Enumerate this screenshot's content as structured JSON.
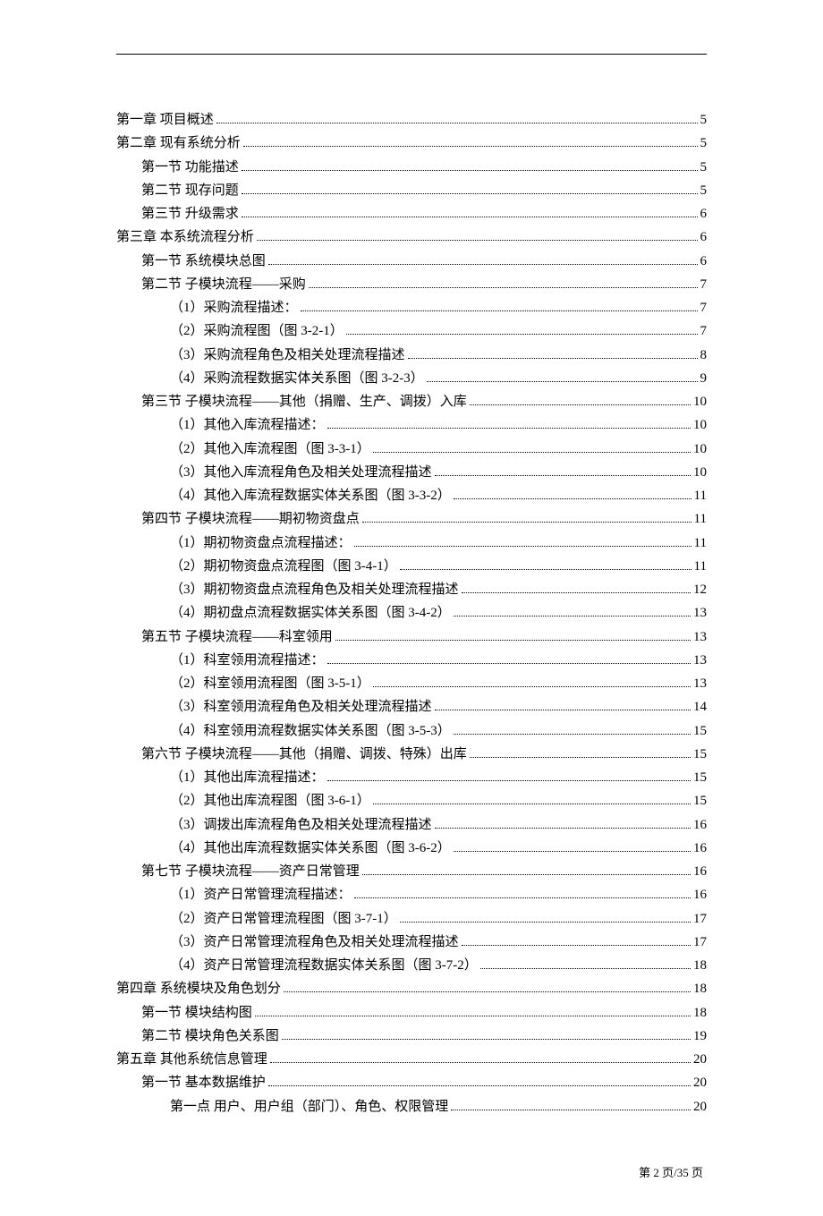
{
  "toc": [
    {
      "level": 0,
      "label": "第一章  项目概述",
      "page": "5"
    },
    {
      "level": 0,
      "label": "第二章  现有系统分析",
      "page": "5"
    },
    {
      "level": 1,
      "label": "第一节  功能描述",
      "page": "5"
    },
    {
      "level": 1,
      "label": "第二节  现存问题",
      "page": "5"
    },
    {
      "level": 1,
      "label": "第三节  升级需求",
      "page": "6"
    },
    {
      "level": 0,
      "label": "第三章  本系统流程分析",
      "page": "6"
    },
    {
      "level": 1,
      "label": "第一节  系统模块总图",
      "page": "6"
    },
    {
      "level": 1,
      "label": "第二节  子模块流程——采购",
      "page": "7"
    },
    {
      "level": 2,
      "label": "（1）采购流程描述：",
      "page": "7"
    },
    {
      "level": 2,
      "label": "（2）采购流程图（图 3-2-1）",
      "page": "7"
    },
    {
      "level": 2,
      "label": "（3）采购流程角色及相关处理流程描述",
      "page": "8"
    },
    {
      "level": 2,
      "label": "（4）采购流程数据实体关系图（图 3-2-3）",
      "page": "9"
    },
    {
      "level": 1,
      "label": "第三节  子模块流程——其他（捐赠、生产、调拨）入库",
      "page": "10"
    },
    {
      "level": 2,
      "label": "（1）其他入库流程描述：",
      "page": "10"
    },
    {
      "level": 2,
      "label": "（2）其他入库流程图（图 3-3-1）",
      "page": "10"
    },
    {
      "level": 2,
      "label": "（3）其他入库流程角色及相关处理流程描述",
      "page": "10"
    },
    {
      "level": 2,
      "label": "（4）其他入库流程数据实体关系图（图 3-3-2）",
      "page": "11"
    },
    {
      "level": 1,
      "label": "第四节  子模块流程——期初物资盘点",
      "page": "11"
    },
    {
      "level": 2,
      "label": "（1）期初物资盘点流程描述：",
      "page": "11"
    },
    {
      "level": 2,
      "label": "（2）期初物资盘点流程图（图 3-4-1）",
      "page": "11"
    },
    {
      "level": 2,
      "label": "（3）期初物资盘点流程角色及相关处理流程描述",
      "page": "12"
    },
    {
      "level": 2,
      "label": "（4）期初盘点流程数据实体关系图（图 3-4-2）",
      "page": "13"
    },
    {
      "level": 1,
      "label": "第五节  子模块流程——科室领用",
      "page": "13"
    },
    {
      "level": 2,
      "label": "（1）科室领用流程描述：",
      "page": "13"
    },
    {
      "level": 2,
      "label": "（2）科室领用流程图（图 3-5-1）",
      "page": "13"
    },
    {
      "level": 2,
      "label": "（3）科室领用流程角色及相关处理流程描述",
      "page": "14"
    },
    {
      "level": 2,
      "label": "（4）科室领用流程数据实体关系图（图 3-5-3）",
      "page": "15"
    },
    {
      "level": 1,
      "label": "第六节  子模块流程——其他（捐赠、调拨、特殊）出库",
      "page": "15"
    },
    {
      "level": 2,
      "label": "（1）其他出库流程描述：",
      "page": "15"
    },
    {
      "level": 2,
      "label": "（2）其他出库流程图（图 3-6-1）",
      "page": "15"
    },
    {
      "level": 2,
      "label": "（3）调拨出库流程角色及相关处理流程描述",
      "page": "16"
    },
    {
      "level": 2,
      "label": "（4）其他出库流程数据实体关系图（图 3-6-2）",
      "page": "16"
    },
    {
      "level": 1,
      "label": "第七节  子模块流程——资产日常管理",
      "page": "16"
    },
    {
      "level": 2,
      "label": "（1）资产日常管理流程描述：",
      "page": "16"
    },
    {
      "level": 2,
      "label": "（2）资产日常管理流程图（图 3-7-1）",
      "page": "17"
    },
    {
      "level": 2,
      "label": "（3）资产日常管理流程角色及相关处理流程描述",
      "page": "17"
    },
    {
      "level": 2,
      "label": "（4）资产日常管理流程数据实体关系图（图 3-7-2）",
      "page": "18"
    },
    {
      "level": 0,
      "label": "第四章  系统模块及角色划分",
      "page": "18"
    },
    {
      "level": 1,
      "label": "第一节  模块结构图",
      "page": "18"
    },
    {
      "level": 1,
      "label": "第二节  模块角色关系图",
      "page": "19"
    },
    {
      "level": 0,
      "label": "第五章  其他系统信息管理",
      "page": "20"
    },
    {
      "level": 1,
      "label": "第一节  基本数据维护",
      "page": "20"
    },
    {
      "level": 2,
      "label": "第一点 用户、用户组（部门）、角色、权限管理",
      "page": "20"
    }
  ],
  "footer": "第 2 页/35 页"
}
